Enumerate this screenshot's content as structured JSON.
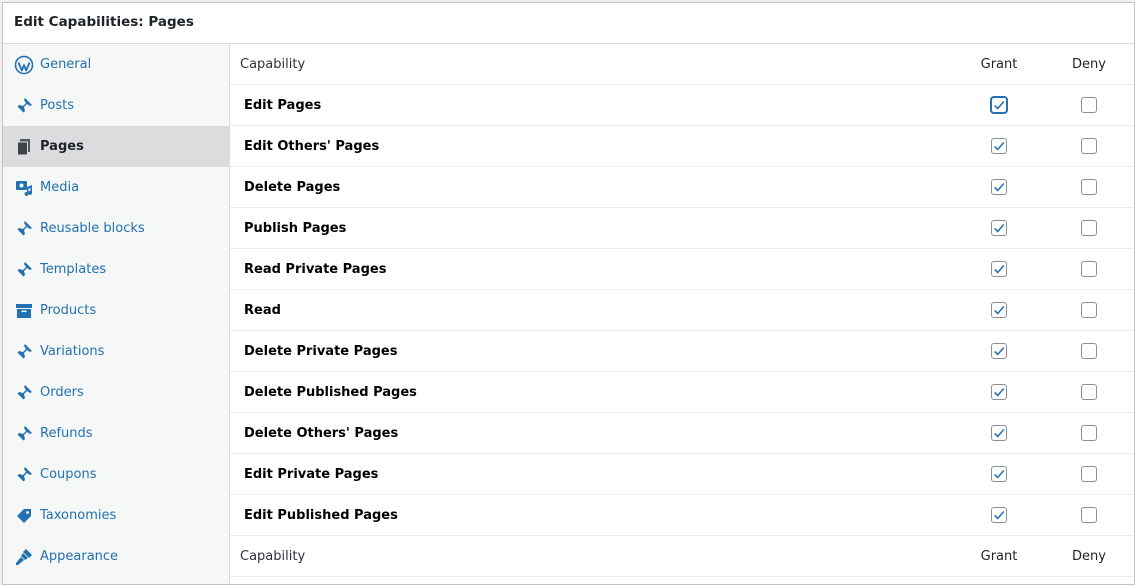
{
  "panel": {
    "title": "Edit Capabilities: Pages"
  },
  "sidebar": {
    "items": [
      {
        "label": "General",
        "icon": "wordpress-icon"
      },
      {
        "label": "Posts",
        "icon": "pin-icon"
      },
      {
        "label": "Pages",
        "icon": "pages-icon",
        "active": true
      },
      {
        "label": "Media",
        "icon": "media-icon"
      },
      {
        "label": "Reusable blocks",
        "icon": "pin-icon"
      },
      {
        "label": "Templates",
        "icon": "pin-icon"
      },
      {
        "label": "Products",
        "icon": "archive-icon"
      },
      {
        "label": "Variations",
        "icon": "pin-icon"
      },
      {
        "label": "Orders",
        "icon": "pin-icon"
      },
      {
        "label": "Refunds",
        "icon": "pin-icon"
      },
      {
        "label": "Coupons",
        "icon": "pin-icon"
      },
      {
        "label": "Taxonomies",
        "icon": "tag-icon"
      },
      {
        "label": "Appearance",
        "icon": "brush-icon"
      }
    ]
  },
  "table": {
    "header": {
      "capability": "Capability",
      "grant": "Grant",
      "deny": "Deny"
    },
    "rows": [
      {
        "capability": "Edit Pages",
        "grant": true,
        "deny": false
      },
      {
        "capability": "Edit Others' Pages",
        "grant": true,
        "deny": false
      },
      {
        "capability": "Delete Pages",
        "grant": true,
        "deny": false
      },
      {
        "capability": "Publish Pages",
        "grant": true,
        "deny": false
      },
      {
        "capability": "Read Private Pages",
        "grant": true,
        "deny": false
      },
      {
        "capability": "Read",
        "grant": true,
        "deny": false
      },
      {
        "capability": "Delete Private Pages",
        "grant": true,
        "deny": false
      },
      {
        "capability": "Delete Published Pages",
        "grant": true,
        "deny": false
      },
      {
        "capability": "Delete Others' Pages",
        "grant": true,
        "deny": false
      },
      {
        "capability": "Edit Private Pages",
        "grant": true,
        "deny": false
      },
      {
        "capability": "Edit Published Pages",
        "grant": true,
        "deny": false
      }
    ],
    "footer": {
      "capability": "Capability",
      "grant": "Grant",
      "deny": "Deny"
    }
  },
  "colors": {
    "link": "#2271b1",
    "active_bg": "#dcdcde",
    "sidebar_bg": "#f6f7f7"
  }
}
